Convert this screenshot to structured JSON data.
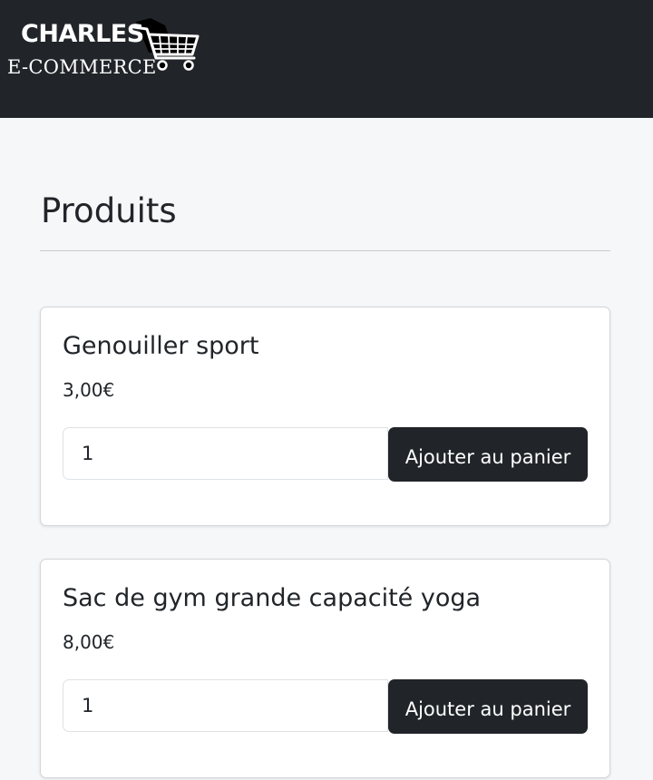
{
  "header": {
    "brand_line1": "CHARLES",
    "brand_line2": "E-COMMERCE",
    "logo_icon": "shopping-cart-tag-icon",
    "background_color": "#212529"
  },
  "main": {
    "title": "Produits",
    "products": [
      {
        "name": "Genouiller sport",
        "price": "3,00€",
        "quantity": "1",
        "button_label": "Ajouter au panier"
      },
      {
        "name": "Sac de gym grande capacité yoga",
        "price": "8,00€",
        "quantity": "1",
        "button_label": "Ajouter au panier"
      }
    ]
  },
  "colors": {
    "page_background": "#f6f7f9",
    "button_background": "#212529",
    "card_background": "#ffffff"
  }
}
